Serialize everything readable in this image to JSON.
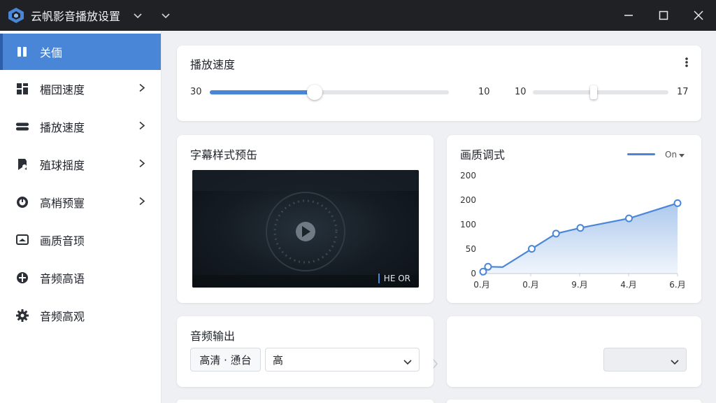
{
  "window": {
    "title": "云帆影音播放设置"
  },
  "sidebar": {
    "items": [
      {
        "label": "关偭",
        "icon": "pause-icon",
        "active": true,
        "chevron": false
      },
      {
        "label": "楣団速度",
        "icon": "grid-icon",
        "active": false,
        "chevron": true
      },
      {
        "label": "播放速度",
        "icon": "speed-icon",
        "active": false,
        "chevron": true
      },
      {
        "label": "殖球揺度",
        "icon": "bookmark-icon",
        "active": false,
        "chevron": true
      },
      {
        "label": "高梢预寷",
        "icon": "power-icon",
        "active": false,
        "chevron": true
      },
      {
        "label": "画质音顼",
        "icon": "display-icon",
        "active": false,
        "chevron": false
      },
      {
        "label": "音频高语",
        "icon": "compass-icon",
        "active": false,
        "chevron": false
      },
      {
        "label": "音频高观",
        "icon": "gear-icon",
        "active": false,
        "chevron": false
      }
    ]
  },
  "speed_card": {
    "title": "播放速度",
    "slider1": {
      "min_label": "30",
      "max_label": "10",
      "fill_fraction": 0.44
    },
    "slider2": {
      "min_label": "10",
      "max_label": "17",
      "fill_fraction": 0.45
    }
  },
  "subtitle_card": {
    "title": "字幕样式预缶",
    "badge": "HE OR"
  },
  "quality_card": {
    "title": "画质调式",
    "legend_label": "On"
  },
  "chart_data": {
    "type": "area",
    "x_labels": [
      "0.月",
      "0.月",
      "9.月",
      "4.月",
      "6.月"
    ],
    "y_ticks": [
      "0",
      "50",
      "100",
      "200",
      "200"
    ],
    "ylim": [
      0,
      250
    ],
    "x": [
      0,
      0.1,
      0.4,
      1.0,
      1.5,
      2.0,
      3.0,
      4.0
    ],
    "values": [
      5,
      18,
      17,
      65,
      105,
      120,
      145,
      185
    ],
    "color": "#4a86d8",
    "grid": false
  },
  "audio_card": {
    "title": "音频输出",
    "chip_label": "高清 · 慂台",
    "select_value": "高"
  },
  "colors": {
    "accent": "#4a86d8",
    "titlebar": "#1f2125"
  }
}
